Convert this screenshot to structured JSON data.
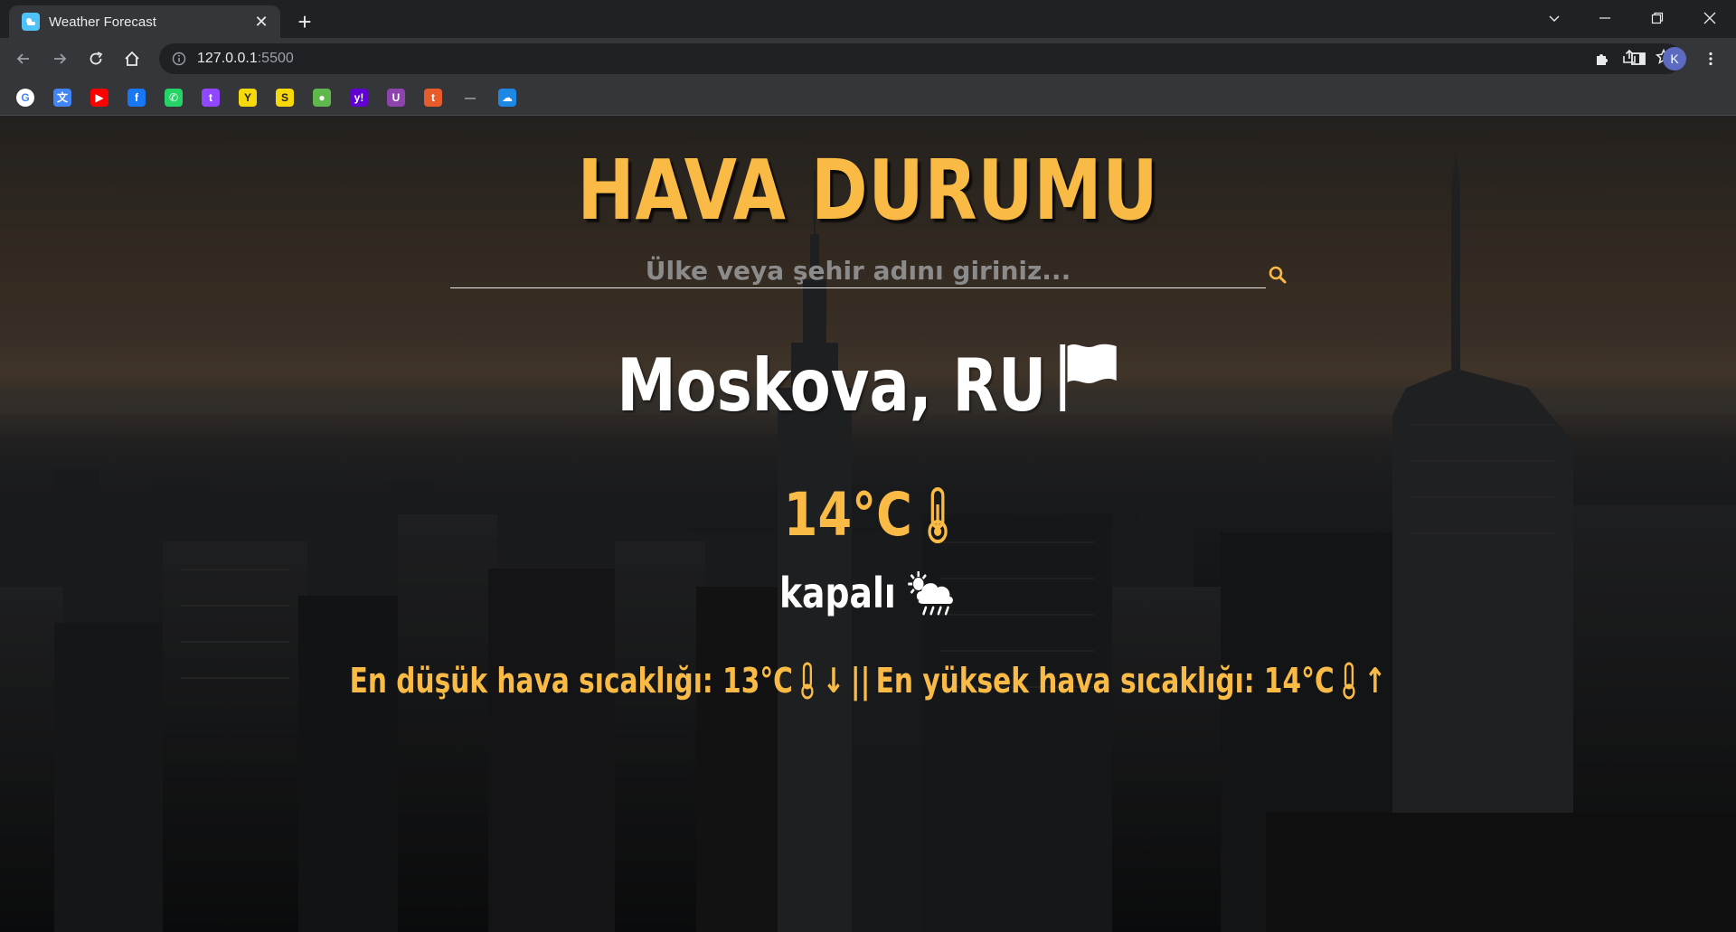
{
  "browser": {
    "tab_title": "Weather Forecast",
    "url_host": "127.0.0.1",
    "url_port": ":5500",
    "avatar_letter": "K"
  },
  "bookmarks": [
    {
      "name": "google",
      "color": "#ffffff",
      "glyph": "G"
    },
    {
      "name": "translate",
      "color": "#4285f4",
      "glyph": "文"
    },
    {
      "name": "youtube",
      "color": "#ff0000",
      "glyph": "▶"
    },
    {
      "name": "facebook",
      "color": "#1877f2",
      "glyph": "f"
    },
    {
      "name": "whatsapp",
      "color": "#25d366",
      "glyph": "✆"
    },
    {
      "name": "twitch",
      "color": "#9146ff",
      "glyph": "t"
    },
    {
      "name": "yellow-app",
      "color": "#f5d90a",
      "glyph": "Y"
    },
    {
      "name": "s-app",
      "color": "#f5d90a",
      "glyph": "S"
    },
    {
      "name": "drop",
      "color": "#5fb84b",
      "glyph": "●"
    },
    {
      "name": "yahoo",
      "color": "#6001d2",
      "glyph": "y!"
    },
    {
      "name": "purple-app",
      "color": "#8e44ad",
      "glyph": "U"
    },
    {
      "name": "orange-app",
      "color": "#e65c2b",
      "glyph": "t"
    },
    {
      "name": "dash",
      "color": "#35363a",
      "glyph": "—"
    },
    {
      "name": "cloud-app",
      "color": "#1e88e5",
      "glyph": "☁"
    }
  ],
  "weather": {
    "title": "HAVA DURUMU",
    "search_placeholder": "Ülke veya şehir adını giriniz...",
    "city": "Moskova, RU",
    "temperature": "14°C",
    "description": "kapalı",
    "min_label": "En düşük hava sıcaklığı: 13°C",
    "separator": "||",
    "max_label": "En yüksek hava sıcaklığı: 14°C",
    "down_arrow": "↓",
    "up_arrow": "↑"
  },
  "colors": {
    "accent": "#f9bb45",
    "text": "#ffffff"
  }
}
